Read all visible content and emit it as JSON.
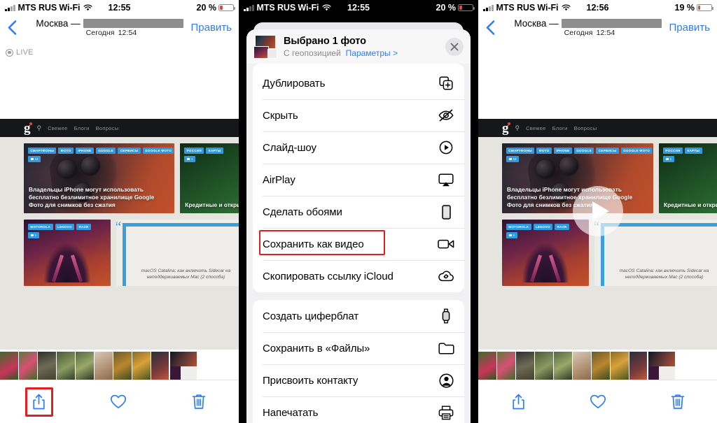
{
  "panels": {
    "left": {
      "status": {
        "carrier": "MTS RUS Wi-Fi",
        "time": "12:55",
        "battery": "20 %",
        "battery_pct": 20
      },
      "nav": {
        "title_prefix": "Москва —",
        "subtitle": "Сегодня",
        "subtitle_time": "12:54",
        "edit": "Править"
      },
      "live_badge": "LIVE"
    },
    "middle": {
      "status": {
        "carrier": "MTS RUS Wi-Fi",
        "time": "12:55",
        "battery": "20 %",
        "battery_pct": 20
      },
      "sheet": {
        "title": "Выбрано 1 фото",
        "subtitle": "С геопозицией",
        "options_link": "Параметры >",
        "groups": [
          {
            "items": [
              {
                "label": "Дублировать",
                "icon": "duplicate-icon"
              },
              {
                "label": "Скрыть",
                "icon": "hide-eye-icon"
              },
              {
                "label": "Слайд-шоу",
                "icon": "slideshow-play-icon"
              },
              {
                "label": "AirPlay",
                "icon": "airplay-icon"
              },
              {
                "label": "Сделать обоями",
                "icon": "wallpaper-phone-icon"
              },
              {
                "label": "Сохранить как видео",
                "icon": "video-camera-icon",
                "highlighted": true
              },
              {
                "label": "Скопировать ссылку iCloud",
                "icon": "icloud-link-icon"
              }
            ]
          },
          {
            "items": [
              {
                "label": "Создать циферблат",
                "icon": "watch-face-icon"
              },
              {
                "label": "Сохранить в «Файлы»",
                "icon": "folder-icon"
              },
              {
                "label": "Присвоить контакту",
                "icon": "contact-person-icon"
              },
              {
                "label": "Напечатать",
                "icon": "printer-icon"
              }
            ]
          }
        ]
      }
    },
    "right": {
      "status": {
        "carrier": "MTS RUS Wi-Fi",
        "time": "12:56",
        "battery": "19 %",
        "battery_pct": 19
      },
      "nav": {
        "title_prefix": "Москва —",
        "subtitle": "Сегодня",
        "subtitle_time": "12:54",
        "edit": "Править"
      },
      "play_overlay": true
    }
  },
  "photo_content": {
    "site": {
      "logo": "g",
      "links": [
        "Свежее",
        "Блоги",
        "Вопросы"
      ],
      "search": "search-icon"
    },
    "card_a": {
      "tags": [
        "СМАРТФОНЫ",
        "ФОТО",
        "IPHONE",
        "GOOGLE",
        "СЕРВИСЫ",
        "GOOGLE ФОТО"
      ],
      "comments": "12",
      "headline": "Владельцы iPhone могут использовать бесплатно безлимитное хранилище Google Фото для снимков без сжатия"
    },
    "card_b": {
      "tags": [
        "РОССИЯ",
        "КАРТЫ"
      ],
      "comments": "1",
      "headline": "Кредитные и открытый до"
    },
    "card_c": {
      "tags": [
        "MOTOROLA",
        "LENOVO",
        "RAZR"
      ],
      "comments": "1"
    },
    "quote": {
      "text": "macOS Catalina: как включить Sidecar на неподдерживаемых Mac (2 способа)"
    }
  },
  "toolbar": {
    "share": "share-icon",
    "favorite": "heart-icon",
    "delete": "trash-icon"
  },
  "colors": {
    "accent_blue": "#2f7cf6",
    "highlight_red": "#e02020",
    "tag_blue": "#2f9ae0",
    "battery_red": "#e8453c"
  }
}
